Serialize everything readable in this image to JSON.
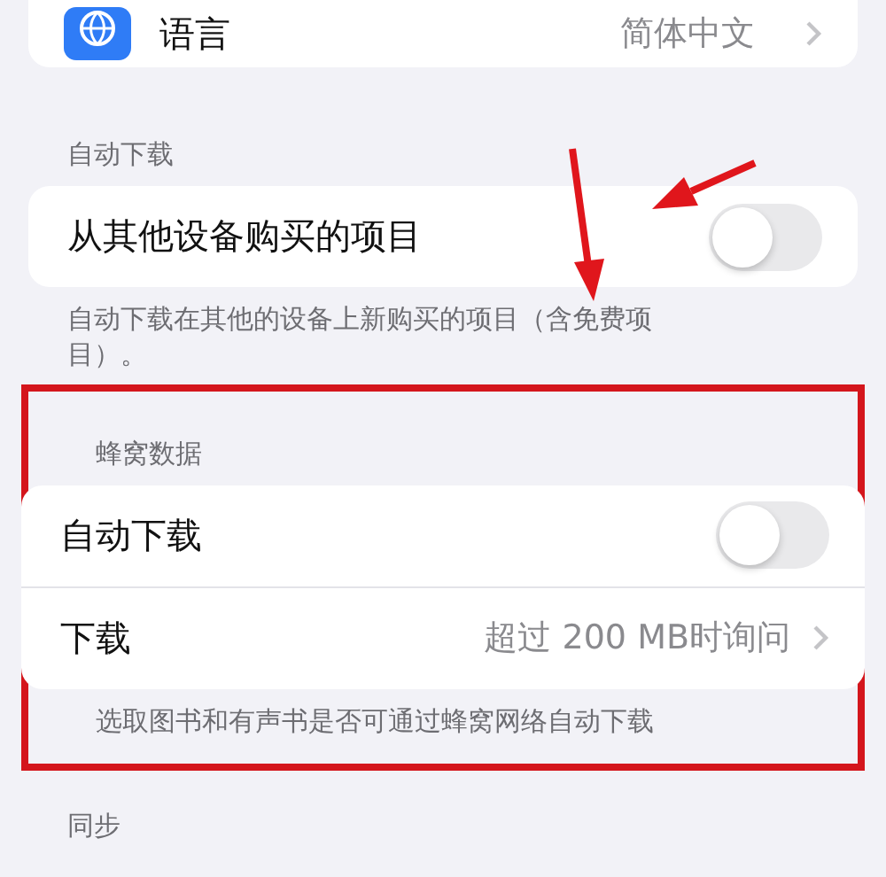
{
  "top_row": {
    "label": "语言",
    "value": "简体中文"
  },
  "sections": [
    {
      "header": "自动下载",
      "highlighted": false,
      "rows": [
        {
          "kind": "toggle",
          "label": "从其他设备购买的项目",
          "on": false
        }
      ],
      "footer": "自动下载在其他的设备上新购买的项目（含免费项目）。"
    },
    {
      "header": "蜂窝数据",
      "highlighted": true,
      "rows": [
        {
          "kind": "toggle",
          "label": "自动下载",
          "on": false
        },
        {
          "kind": "link",
          "label": "下载",
          "value": "超过 200 MB时询问"
        }
      ],
      "footer": "选取图书和有声书是否可通过蜂窝网络自动下载"
    },
    {
      "header": "同步",
      "highlighted": false
    }
  ]
}
